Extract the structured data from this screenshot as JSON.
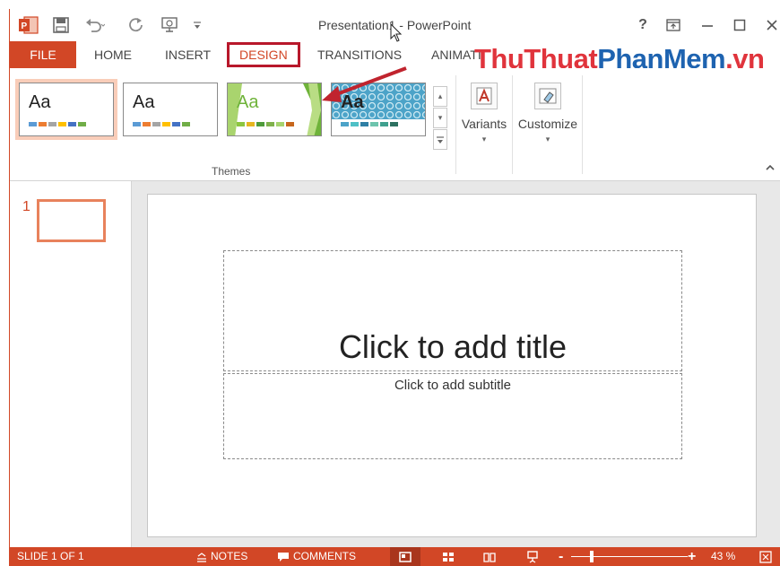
{
  "window": {
    "title": "Presentation1 - PowerPoint",
    "help_label": "?"
  },
  "tabs": [
    {
      "id": "file",
      "label": "FILE"
    },
    {
      "id": "home",
      "label": "HOME"
    },
    {
      "id": "insert",
      "label": "INSERT"
    },
    {
      "id": "design",
      "label": "DESIGN"
    },
    {
      "id": "transitions",
      "label": "TRANSITIONS"
    },
    {
      "id": "animations",
      "label": "ANIMATI"
    }
  ],
  "watermark": {
    "part1": "ThuThuat",
    "part2": "PhanMem",
    "part3": ".vn"
  },
  "ribbon": {
    "themes": [
      {
        "label": "Aa",
        "colors": [
          "#5b9bd5",
          "#ed7d31",
          "#a5a5a5",
          "#ffc000",
          "#4472c4",
          "#70ad47"
        ]
      },
      {
        "label": "Aa",
        "colors": [
          "#5b9bd5",
          "#ed7d31",
          "#a5a5a5",
          "#ffc000",
          "#4472c4",
          "#70ad47"
        ]
      },
      {
        "label": "Aa",
        "colors": [
          "#8cc63f",
          "#e6b620",
          "#4e9b3a",
          "#7fb14c",
          "#a6d36e",
          "#c7661c"
        ]
      },
      {
        "label": "Aa",
        "colors": [
          "#4ca3c8",
          "#4ec0c6",
          "#2f7fa5",
          "#6dc4ad",
          "#3fa08e",
          "#2d7060"
        ]
      }
    ],
    "group_label": "Themes",
    "variants_label": "Variants",
    "customize_label": "Customize",
    "dropdown_glyph": "▾",
    "scroll_up": "▴",
    "scroll_down": "▾",
    "more": "▾"
  },
  "slide_panel": {
    "slide_number": "1"
  },
  "slide": {
    "title_placeholder": "Click to add title",
    "subtitle_placeholder": "Click to add subtitle"
  },
  "status": {
    "slide_info": "SLIDE 1 OF 1",
    "notes_label": "NOTES",
    "comments_label": "COMMENTS",
    "zoom_percent": "43 %",
    "zoom_out": "-",
    "zoom_in": "+"
  },
  "colors": {
    "accent": "#d24726",
    "highlight_box": "#b8182b",
    "selected_theme_bg": "#f9cdb9"
  }
}
